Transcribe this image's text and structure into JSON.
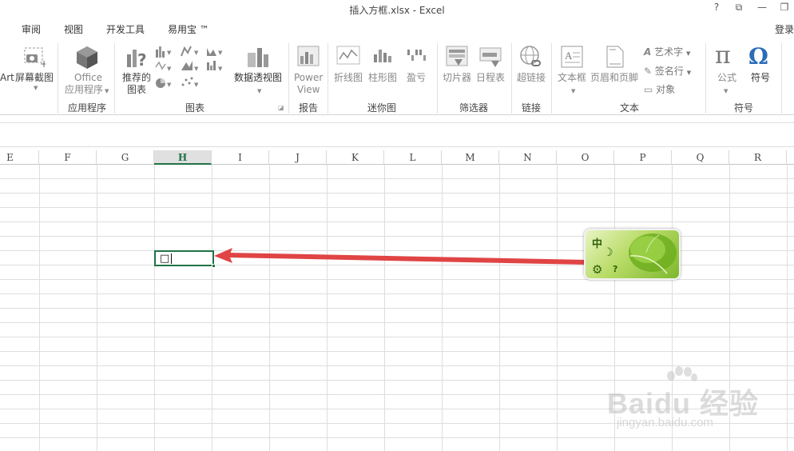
{
  "window": {
    "title": "插入方框.xlsx - Excel",
    "controls": [
      "?",
      "⧉",
      "—",
      "❐"
    ]
  },
  "tabs": [
    "审阅",
    "视图",
    "开发工具",
    "易用宝 ™"
  ],
  "login_label": "登录",
  "ribbon": {
    "partial_art": "Art",
    "screenshot": "屏幕截图",
    "office_apps_line1": "Office",
    "office_apps_line2": "应用程序",
    "recommended_line1": "推荐的",
    "recommended_line2": "图表",
    "pivot_chart": "数据透视图",
    "power_view_line1": "Power",
    "power_view_line2": "View",
    "sparkline_line": "折线图",
    "sparkline_column": "柱形图",
    "sparkline_winloss": "盈亏",
    "slicer": "切片器",
    "timeline": "日程表",
    "hyperlink": "超链接",
    "textbox": "文本框",
    "header_footer": "页眉和页脚",
    "wordart": "艺术字",
    "signature_line": "签名行",
    "object": "对象",
    "equation": "公式",
    "symbol": "符号",
    "groups": {
      "apps": "应用程序",
      "charts": "图表",
      "reports": "报告",
      "sparklines": "迷你图",
      "filters": "筛选器",
      "links": "链接",
      "text": "文本",
      "symbols": "符号"
    }
  },
  "columns": [
    "E",
    "F",
    "G",
    "H",
    "I",
    "J",
    "K",
    "L",
    "M",
    "N",
    "O",
    "P",
    "Q",
    "R"
  ],
  "selected_column": "H",
  "active_cell": {
    "content": "□"
  },
  "ime": {
    "mode": "中",
    "moon_icon": "crescent-moon-icon",
    "gear_icon": "gear-icon",
    "help": "?"
  },
  "watermark": {
    "brand": "Baidu 经验",
    "url": "jingyan.baidu.com"
  },
  "colors": {
    "excel_green": "#217346",
    "arrow_red": "#e04444",
    "ime_green": "#7db82e"
  }
}
